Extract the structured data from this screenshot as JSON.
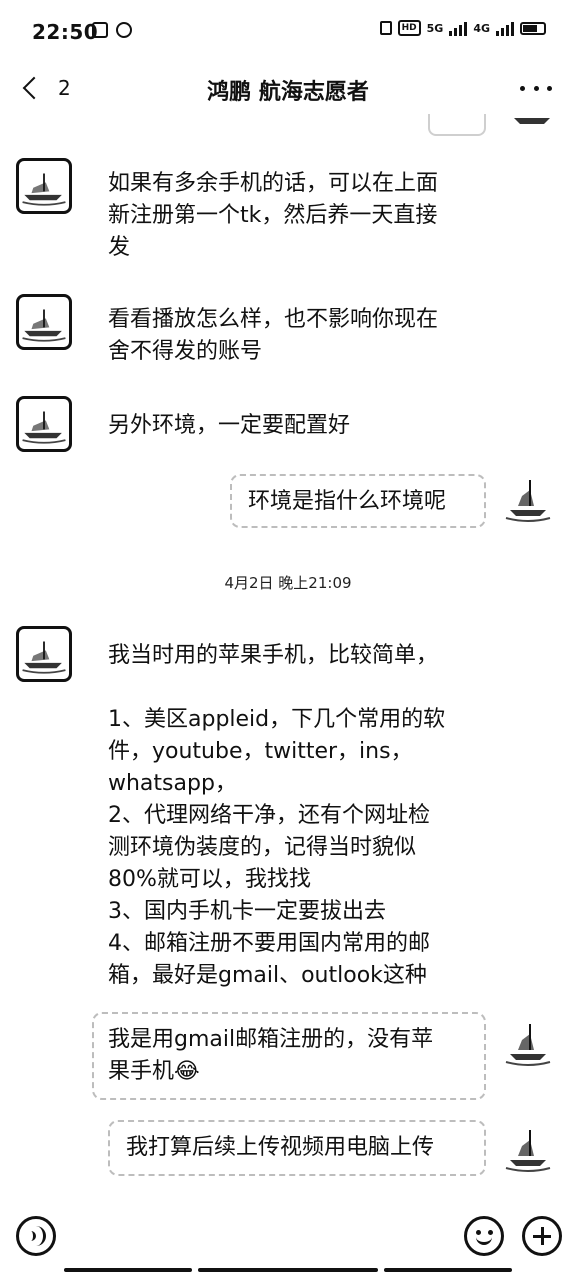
{
  "status_bar": {
    "time": "22:50",
    "net_5g": "5G",
    "net_4g": "4G"
  },
  "header": {
    "back_count": "2",
    "title": "鸿鹏 航海志愿者"
  },
  "messages": [
    {
      "side": "in",
      "text": "如果有多余手机的话，可以在上面\n新注册第一个tk，然后养一天直接\n发"
    },
    {
      "side": "in",
      "text": "看看播放怎么样，也不影响你现在\n舍不得发的账号"
    },
    {
      "side": "in",
      "text": "另外环境，一定要配置好"
    },
    {
      "side": "out",
      "text": "环境是指什么环境呢"
    },
    {
      "side": "in",
      "text": "我当时用的苹果手机，比较简单，\n\n1、美区appleid，下几个常用的软\n件，youtube，twitter，ins，\nwhatsapp，\n2、代理网络干净，还有个网址检\n测环境伪装度的，记得当时貌似\n80%就可以，我找找\n3、国内手机卡一定要拔出去\n4、邮箱注册不要用国内常用的邮\n箱，最好是gmail、outlook这种"
    },
    {
      "side": "out",
      "text": "我是用gmail邮箱注册的，没有苹\n果手机😂"
    },
    {
      "side": "out",
      "text": "我打算后续上传视频用电脑上传"
    }
  ],
  "time_divider": "4月2日 晚上21:09",
  "input": {
    "placeholder": ""
  },
  "icons": {
    "back": "chevron-left-icon",
    "more": "more-dots-icon",
    "voice": "voice-icon",
    "emoji": "emoji-icon",
    "plus": "plus-icon",
    "avatar": "boat-avatar"
  }
}
